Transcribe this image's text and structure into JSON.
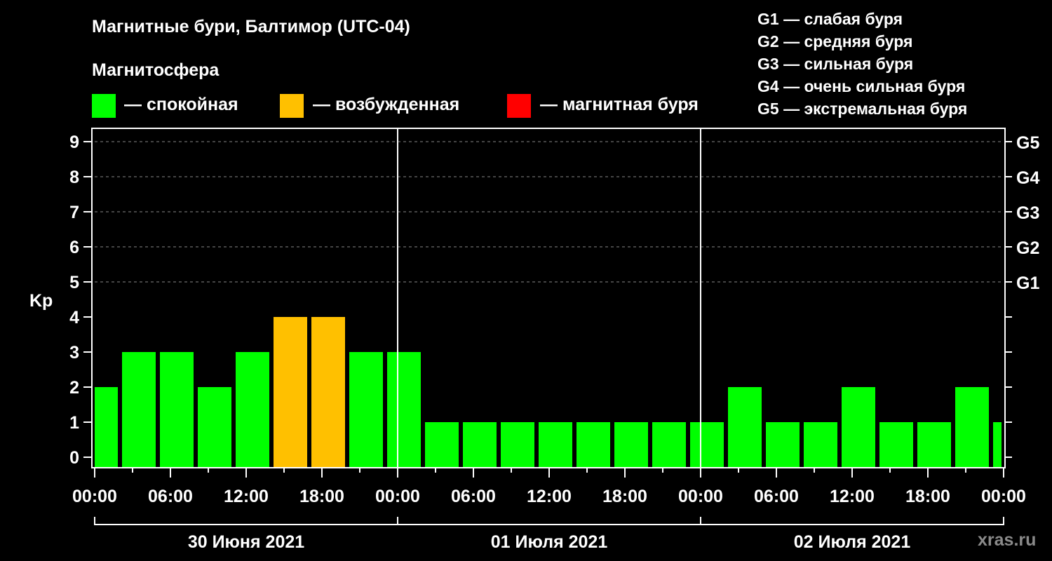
{
  "title": "Магнитные бури, Балтимор (UTC-04)",
  "legend": {
    "heading": "Магнитосфера",
    "items": [
      {
        "label": "— спокойная",
        "color": "#00ff00"
      },
      {
        "label": "— возбужденная",
        "color": "#ffc000"
      },
      {
        "label": "— магнитная буря",
        "color": "#ff0000"
      }
    ],
    "g_scale": [
      "G1 — слабая буря",
      "G2 — средняя буря",
      "G3 — сильная буря",
      "G4 — очень сильная буря",
      "G5 — экстремальная буря"
    ]
  },
  "watermark": "xras.ru",
  "chart_data": {
    "type": "bar",
    "ylabel": "Kp",
    "ylim": [
      -0.3,
      9.6
    ],
    "yticks": [
      "0",
      "1",
      "2",
      "3",
      "4",
      "5",
      "6",
      "7",
      "8",
      "9"
    ],
    "right_ticks": [
      {
        "kp": 5,
        "label": "G1"
      },
      {
        "kp": 6,
        "label": "G2"
      },
      {
        "kp": 7,
        "label": "G3"
      },
      {
        "kp": 8,
        "label": "G4"
      },
      {
        "kp": 9,
        "label": "G5"
      }
    ],
    "grid_levels": [
      5,
      6,
      7,
      8,
      9
    ],
    "xlim_hours": [
      0,
      72
    ],
    "xtick_labels": [
      "00:00",
      "06:00",
      "12:00",
      "18:00",
      "00:00",
      "06:00",
      "12:00",
      "18:00",
      "00:00",
      "06:00",
      "12:00",
      "18:00",
      "00:00"
    ],
    "days": [
      "30 Июня 2021",
      "01 Июля 2021",
      "02 Июля 2021"
    ],
    "interval_hours": 3,
    "first_interval_start_hour": -1,
    "values": [
      2,
      3,
      3,
      2,
      3,
      4,
      4,
      3,
      3,
      1,
      1,
      1,
      1,
      1,
      1,
      1,
      1,
      2,
      1,
      1,
      2,
      1,
      1,
      2,
      1
    ],
    "colors": {
      "quiet": "#00ff00",
      "active": "#ffc000",
      "storm": "#ff0000"
    }
  }
}
